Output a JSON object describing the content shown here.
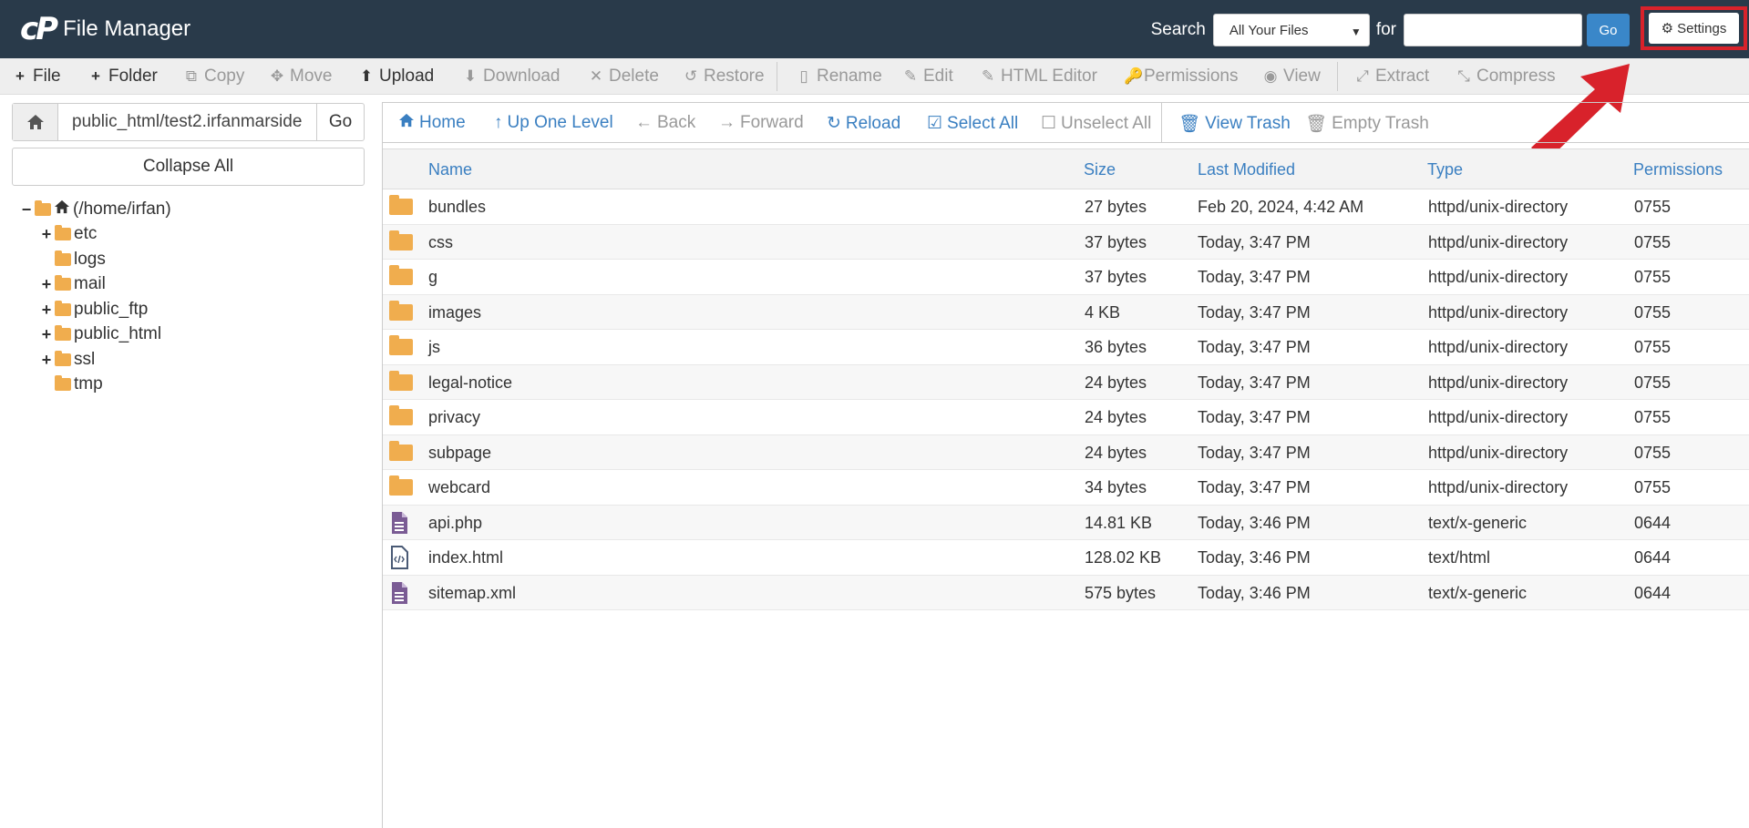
{
  "header": {
    "logo_mark": "cP",
    "app_title": "File Manager",
    "search_label": "Search",
    "search_scope": "All Your Files",
    "for_label": "for",
    "search_value": "",
    "go_label": "Go",
    "settings_label": "Settings"
  },
  "toolbar": {
    "file": "File",
    "folder": "Folder",
    "copy": "Copy",
    "move": "Move",
    "upload": "Upload",
    "download": "Download",
    "delete": "Delete",
    "restore": "Restore",
    "rename": "Rename",
    "edit": "Edit",
    "html_editor": "HTML Editor",
    "permissions": "Permissions",
    "view": "View",
    "extract": "Extract",
    "compress": "Compress"
  },
  "sidebar": {
    "path_value": "public_html/test2.irfanmarside",
    "path_go": "Go",
    "collapse_all": "Collapse All",
    "root_label": "(/home/irfan)",
    "tree": [
      {
        "label": "etc",
        "expandable": "+"
      },
      {
        "label": "logs",
        "expandable": ""
      },
      {
        "label": "mail",
        "expandable": "+"
      },
      {
        "label": "public_ftp",
        "expandable": "+"
      },
      {
        "label": "public_html",
        "expandable": "+"
      },
      {
        "label": "ssl",
        "expandable": "+"
      },
      {
        "label": "tmp",
        "expandable": ""
      }
    ]
  },
  "nav": {
    "home": "Home",
    "up_one_level": "Up One Level",
    "back": "Back",
    "forward": "Forward",
    "reload": "Reload",
    "select_all": "Select All",
    "unselect_all": "Unselect All",
    "view_trash": "View Trash",
    "empty_trash": "Empty Trash"
  },
  "table": {
    "columns": [
      "Name",
      "Size",
      "Last Modified",
      "Type",
      "Permissions"
    ],
    "rows": [
      {
        "kind": "folder",
        "name": "bundles",
        "size": "27 bytes",
        "modified": "Feb 20, 2024, 4:42 AM",
        "type": "httpd/unix-directory",
        "perms": "0755"
      },
      {
        "kind": "folder",
        "name": "css",
        "size": "37 bytes",
        "modified": "Today, 3:47 PM",
        "type": "httpd/unix-directory",
        "perms": "0755"
      },
      {
        "kind": "folder",
        "name": "g",
        "size": "37 bytes",
        "modified": "Today, 3:47 PM",
        "type": "httpd/unix-directory",
        "perms": "0755"
      },
      {
        "kind": "folder",
        "name": "images",
        "size": "4 KB",
        "modified": "Today, 3:47 PM",
        "type": "httpd/unix-directory",
        "perms": "0755"
      },
      {
        "kind": "folder",
        "name": "js",
        "size": "36 bytes",
        "modified": "Today, 3:47 PM",
        "type": "httpd/unix-directory",
        "perms": "0755"
      },
      {
        "kind": "folder",
        "name": "legal-notice",
        "size": "24 bytes",
        "modified": "Today, 3:47 PM",
        "type": "httpd/unix-directory",
        "perms": "0755"
      },
      {
        "kind": "folder",
        "name": "privacy",
        "size": "24 bytes",
        "modified": "Today, 3:47 PM",
        "type": "httpd/unix-directory",
        "perms": "0755"
      },
      {
        "kind": "folder",
        "name": "subpage",
        "size": "24 bytes",
        "modified": "Today, 3:47 PM",
        "type": "httpd/unix-directory",
        "perms": "0755"
      },
      {
        "kind": "folder",
        "name": "webcard",
        "size": "34 bytes",
        "modified": "Today, 3:47 PM",
        "type": "httpd/unix-directory",
        "perms": "0755"
      },
      {
        "kind": "file-text",
        "name": "api.php",
        "size": "14.81 KB",
        "modified": "Today, 3:46 PM",
        "type": "text/x-generic",
        "perms": "0644"
      },
      {
        "kind": "file-code",
        "name": "index.html",
        "size": "128.02 KB",
        "modified": "Today, 3:46 PM",
        "type": "text/html",
        "perms": "0644"
      },
      {
        "kind": "file-text",
        "name": "sitemap.xml",
        "size": "575 bytes",
        "modified": "Today, 3:46 PM",
        "type": "text/x-generic",
        "perms": "0644"
      }
    ]
  },
  "colors": {
    "header_bg": "#293a4a",
    "accent_blue": "#3a87c9",
    "link_blue": "#3a7fc1",
    "folder": "#f0ad4e",
    "file_purple": "#7a5b94",
    "highlight_red": "#d8222b"
  }
}
